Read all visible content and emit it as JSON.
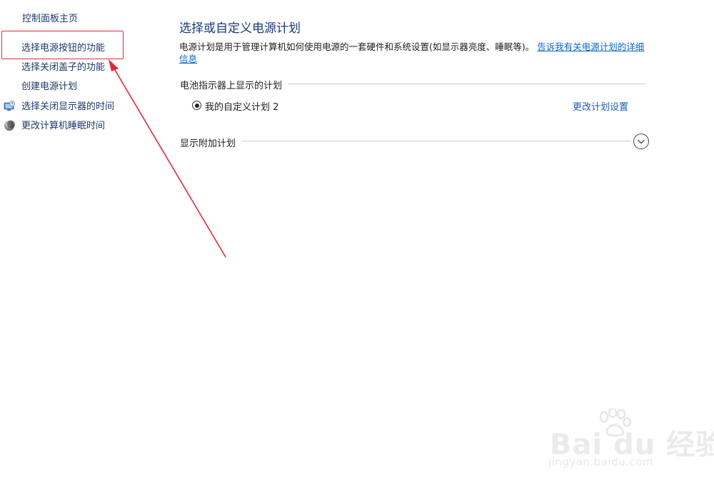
{
  "sidebar": {
    "home_link": "控制面板主页",
    "items": [
      {
        "label": "选择电源按钮的功能",
        "icon": null
      },
      {
        "label": "选择关闭盖子的功能",
        "icon": null
      },
      {
        "label": "创建电源计划",
        "icon": null
      },
      {
        "label": "选择关闭显示器的时间",
        "icon": "display-icon"
      },
      {
        "label": "更改计算机睡眠时间",
        "icon": "sleep-icon"
      }
    ]
  },
  "main": {
    "title": "选择或自定义电源计划",
    "description": "电源计划是用于管理计算机如何使用电源的一套硬件和系统设置(如显示器亮度、睡眠等)。",
    "description_link": "告诉我有关电源计划的详细信息",
    "battery_section": {
      "header": "电池指示器上显示的计划",
      "plan_name": "我的自定义计划 2",
      "plan_selected": true,
      "change_link": "更改计划设置"
    },
    "additional_section": {
      "header": "显示附加计划",
      "expand_icon": "chevron-down-icon"
    }
  },
  "annotation": {
    "highlight_color": "#e02a3c",
    "arrow_color": "#e02a3c"
  },
  "watermark": {
    "brand": "Bai du 经验",
    "url": "jingyan.baidu.com"
  },
  "colors": {
    "nav_link": "#1e3a6a",
    "title": "#1a3a7a",
    "link": "#0a66c8"
  }
}
